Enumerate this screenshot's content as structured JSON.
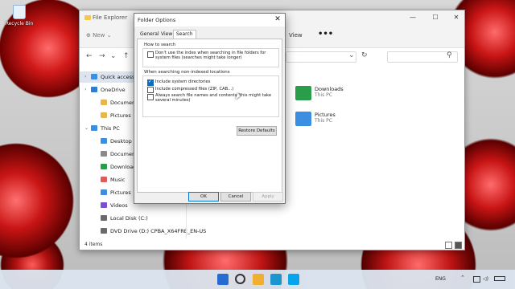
{
  "desktop": {
    "recycle_label": "Recycle Bin"
  },
  "explorer": {
    "title": "File Explorer",
    "new_label": "New",
    "view_label": "View",
    "more_label": "•••",
    "sidebar": [
      {
        "label": "Quick access",
        "icon": "star-icon",
        "color": "#3b8ee0"
      },
      {
        "label": "OneDrive",
        "icon": "cloud-icon",
        "color": "#2f7dd3"
      },
      {
        "label": "Documents",
        "icon": "folder-icon",
        "color": "#e8b64a"
      },
      {
        "label": "Pictures",
        "icon": "folder-icon",
        "color": "#e8b64a"
      },
      {
        "label": "This PC",
        "icon": "monitor-icon",
        "color": "#3b8ee0"
      },
      {
        "label": "Desktop",
        "icon": "desktop-icon",
        "color": "#3b8ee0"
      },
      {
        "label": "Documents",
        "icon": "documents-icon",
        "color": "#8a8a8a"
      },
      {
        "label": "Downloads",
        "icon": "download-icon",
        "color": "#2a9d4a"
      },
      {
        "label": "Music",
        "icon": "music-icon",
        "color": "#e05a5a"
      },
      {
        "label": "Pictures",
        "icon": "pictures-icon",
        "color": "#3b8ee0"
      },
      {
        "label": "Videos",
        "icon": "videos-icon",
        "color": "#7a4fd0"
      },
      {
        "label": "Local Disk (C:)",
        "icon": "disk-icon",
        "color": "#6a6a6a"
      },
      {
        "label": "DVD Drive (D:) CPBA_X64FRE_EN-US",
        "icon": "dvd-icon",
        "color": "#6a6a6a"
      }
    ],
    "folders": [
      {
        "name": "Downloads",
        "sub": "This PC",
        "color": "#2a9d4a"
      },
      {
        "name": "Pictures",
        "sub": "This PC",
        "color": "#3b8ee0"
      }
    ],
    "status": "4 items"
  },
  "dialog": {
    "title": "Folder Options",
    "close": "✕",
    "tabs": [
      "General",
      "View",
      "Search"
    ],
    "active_tab": "Search",
    "how_to_search": "How to search",
    "index_option": "Don't use the index when searching in file folders for system files (searches might take longer)",
    "non_indexed": "When searching non-indexed locations",
    "options": [
      {
        "label": "Include system directories",
        "checked": true
      },
      {
        "label": "Include compressed files (ZIP, CAB...)",
        "checked": false
      },
      {
        "label": "Always search file names and contents (this might take several minutes)",
        "checked": false
      }
    ],
    "restore_defaults": "Restore Defaults",
    "ok": "OK",
    "cancel": "Cancel",
    "apply": "Apply"
  },
  "taskbar": {
    "icons": [
      {
        "name": "windows-start-icon",
        "color": "#1e6fd9"
      },
      {
        "name": "search-icon",
        "color": "#333333"
      },
      {
        "name": "file-explorer-icon",
        "color": "#f2b632"
      },
      {
        "name": "edge-icon",
        "color": "#1a9bd7"
      },
      {
        "name": "skype-icon",
        "color": "#00a2ed"
      }
    ],
    "lang": "ENG"
  }
}
